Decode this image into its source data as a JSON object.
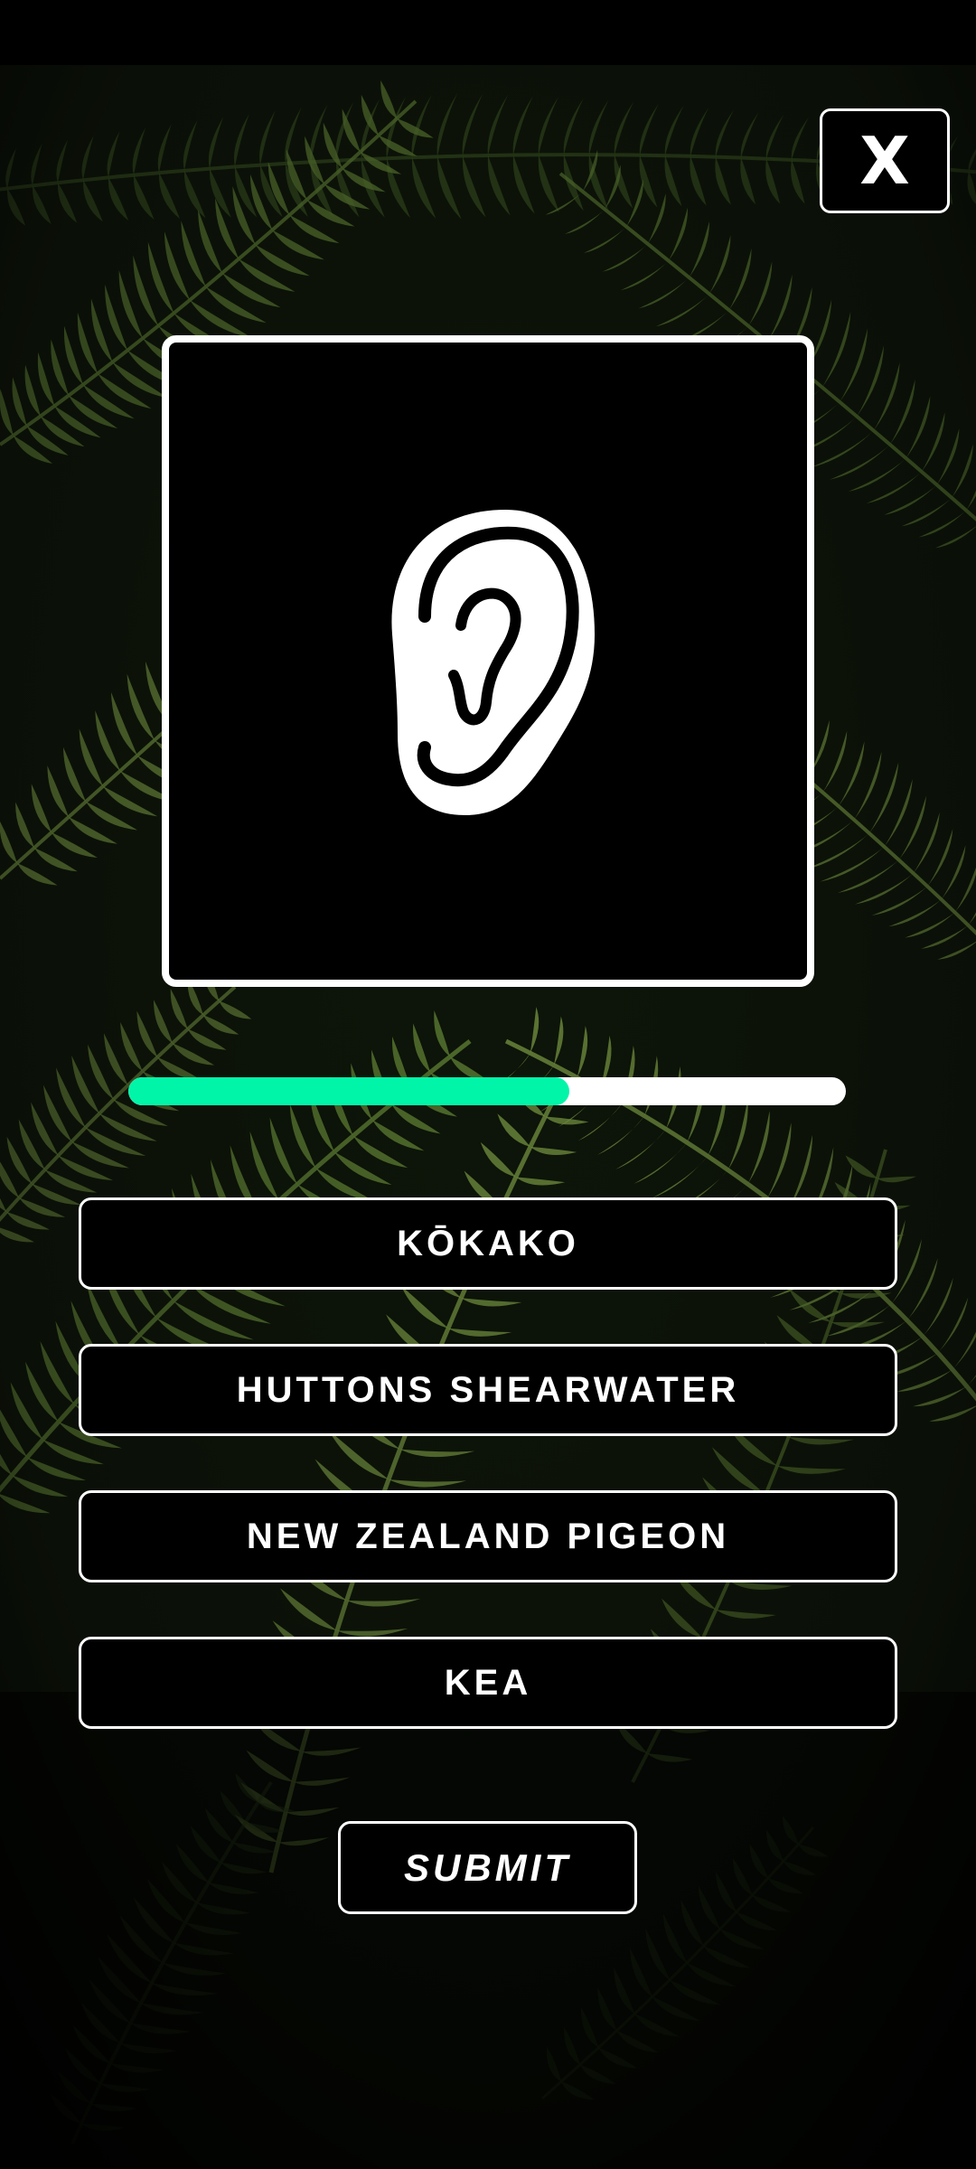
{
  "quiz": {
    "close_label": "X",
    "sound_icon": "ear-icon",
    "progress_fraction": 0.615,
    "options": [
      {
        "label": "KŌKAKO"
      },
      {
        "label": "HUTTONS SHEARWATER"
      },
      {
        "label": "NEW ZEALAND PIGEON"
      },
      {
        "label": "KEA"
      }
    ],
    "submit_label": "SUBMIT"
  },
  "colors": {
    "progress_fill": "#00f5a8",
    "progress_track": "#ffffff",
    "background": "#000000",
    "foreground": "#ffffff"
  }
}
